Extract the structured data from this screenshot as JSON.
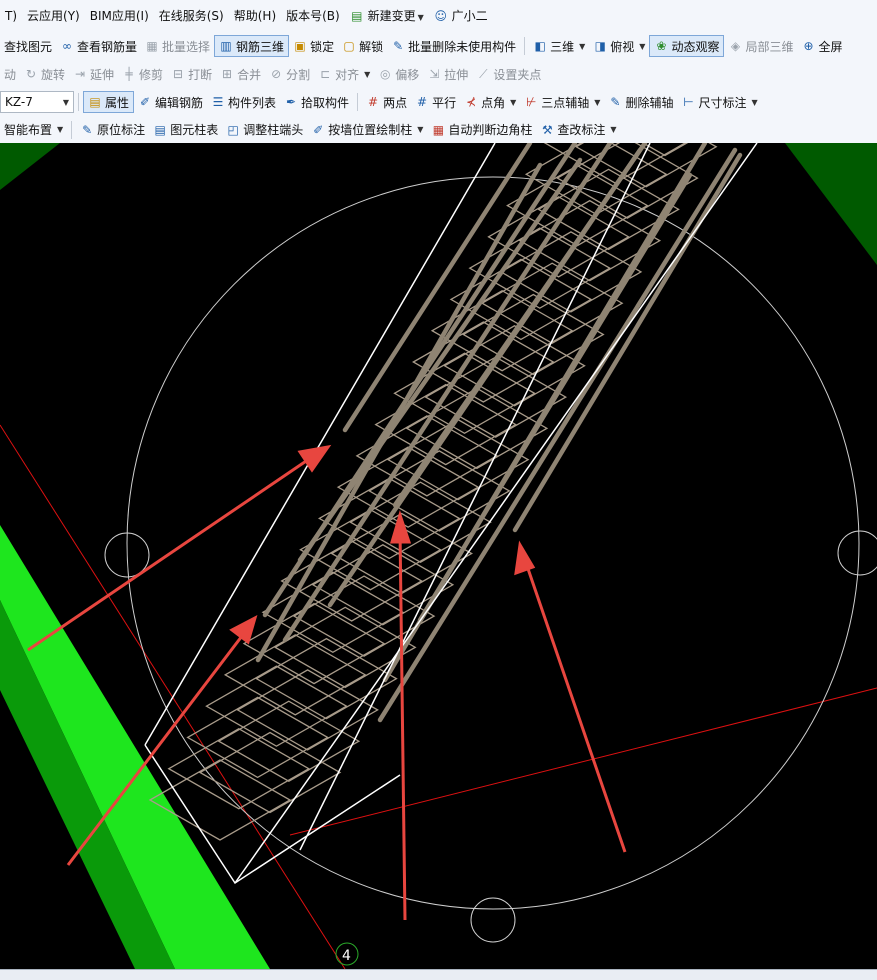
{
  "menu": {
    "items": [
      "T)",
      "云应用(Y)",
      "BIM应用(I)",
      "在线服务(S)",
      "帮助(H)",
      "版本号(B)"
    ],
    "new_change": "新建变更",
    "assistant": "广小二"
  },
  "toolbar1": {
    "find_element": "查找图元",
    "view_rebar": "查看钢筋量",
    "batch_select": "批量选择",
    "rebar_3d": "钢筋三维",
    "lock": "锁定",
    "unlock": "解锁",
    "batch_delete_unused": "批量删除未使用构件",
    "three_d": "三维",
    "top_view": "俯视",
    "dynamic_observe": "动态观察",
    "local_3d": "局部三维",
    "fullscreen": "全屏"
  },
  "toolbar2": {
    "move": "动",
    "rotate": "旋转",
    "extend": "延伸",
    "trim": "修剪",
    "break": "打断",
    "merge": "合并",
    "split": "分割",
    "align": "对齐",
    "offset": "偏移",
    "stretch": "拉伸",
    "set_grip": "设置夹点"
  },
  "toolbar3": {
    "component_select": "KZ-7",
    "properties": "属性",
    "edit_rebar": "编辑钢筋",
    "component_list": "构件列表",
    "pick_component": "拾取构件",
    "two_points": "两点",
    "parallel": "平行",
    "point_angle": "点角",
    "three_point_axis": "三点辅轴",
    "delete_axis": "删除辅轴",
    "dimension": "尺寸标注"
  },
  "toolbar4": {
    "smart_layout": "智能布置",
    "in_place_annotation": "原位标注",
    "element_column_table": "图元柱表",
    "adjust_column_end": "调整柱端头",
    "draw_by_wall": "按墙位置绘制柱",
    "auto_corner_column": "自动判断边角柱",
    "modify_annotation": "查改标注"
  },
  "viewport": {
    "axis_label": "4"
  },
  "colors": {
    "toolbar_bg": "#f3f6fb",
    "viewport_bg": "#000000",
    "rebar": "#9c9080",
    "arrow": "#e8463f",
    "slab_green": "#1ee61e",
    "dark_green": "#005a00"
  }
}
